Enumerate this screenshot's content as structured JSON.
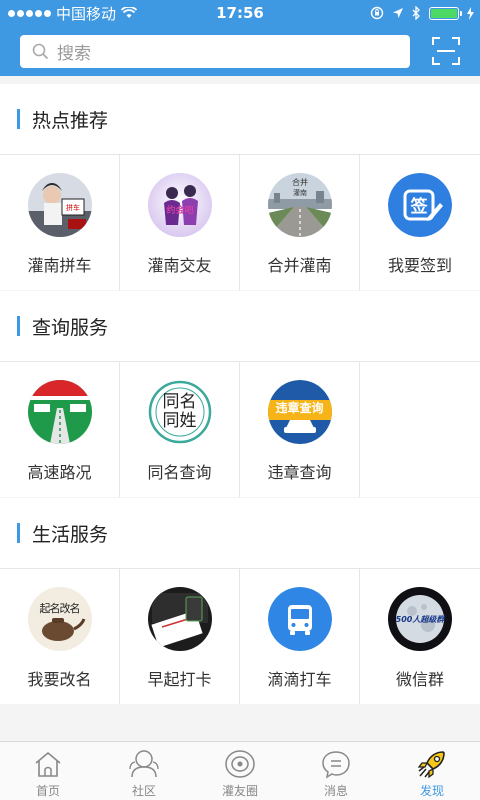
{
  "status_bar": {
    "carrier": "中国移动",
    "time": "17:56"
  },
  "search": {
    "placeholder": "搜索"
  },
  "sections": [
    {
      "title": "热点推荐",
      "items": [
        {
          "label": "灌南拼车",
          "icon": "carpool-photo-icon"
        },
        {
          "label": "灌南交友",
          "icon": "dating-photo-icon"
        },
        {
          "label": "合并灌南",
          "icon": "city-road-photo-icon"
        },
        {
          "label": "我要签到",
          "icon": "checkin-icon"
        }
      ]
    },
    {
      "title": "查询服务",
      "items": [
        {
          "label": "高速路况",
          "icon": "highway-icon"
        },
        {
          "label": "同名查询",
          "icon": "same-name-icon",
          "icon_text": "同名同姓"
        },
        {
          "label": "违章查询",
          "icon": "traffic-violation-icon",
          "icon_text": "违章查询"
        }
      ]
    },
    {
      "title": "生活服务",
      "items": [
        {
          "label": "我要改名",
          "icon": "rename-teapot-icon",
          "icon_text": "起名改名"
        },
        {
          "label": "早起打卡",
          "icon": "morning-card-icon"
        },
        {
          "label": "滴滴打车",
          "icon": "taxi-bus-icon"
        },
        {
          "label": "微信群",
          "icon": "wechat-group-icon",
          "icon_text": "500人超级群"
        }
      ]
    }
  ],
  "tabs": [
    {
      "label": "首页",
      "icon": "home-icon",
      "active": false
    },
    {
      "label": "社区",
      "icon": "community-icon",
      "active": false
    },
    {
      "label": "灌友圈",
      "icon": "friends-circle-icon",
      "active": false
    },
    {
      "label": "消息",
      "icon": "message-icon",
      "active": false
    },
    {
      "label": "发现",
      "icon": "rocket-icon",
      "active": true
    }
  ],
  "colors": {
    "brand": "#3f98e2",
    "active_tab": "#3f98e2"
  }
}
